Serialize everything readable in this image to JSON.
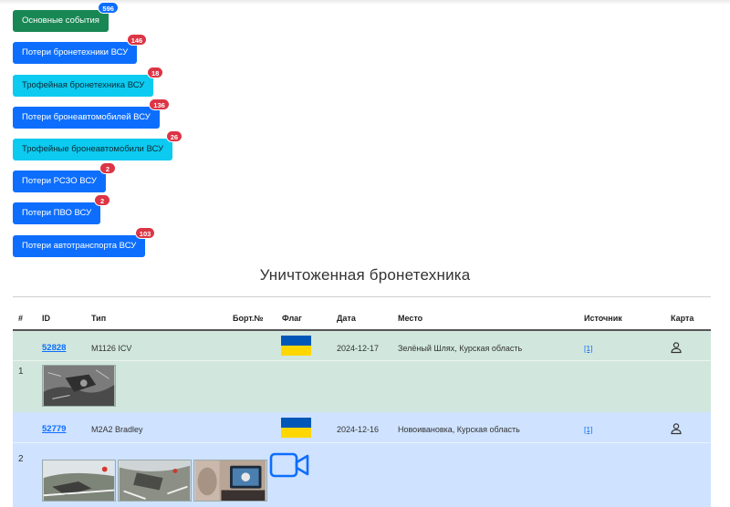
{
  "buttons": [
    {
      "label": "Основные события",
      "count": "596",
      "style": "green",
      "badge": "blue"
    },
    {
      "label": "Потери бронетехники ВСУ",
      "count": "146",
      "style": "blue",
      "badge": "red"
    },
    {
      "label": "Трофейная бронетехника ВСУ",
      "count": "18",
      "style": "cyan",
      "badge": "red"
    },
    {
      "label": "Потери бронеавтомобилей ВСУ",
      "count": "136",
      "style": "blue",
      "badge": "red"
    },
    {
      "label": "Трофейные бронеавтомобили ВСУ",
      "count": "26",
      "style": "cyan",
      "badge": "red"
    },
    {
      "label": "Потери РСЗО ВСУ",
      "count": "2",
      "style": "blue",
      "badge": "red"
    },
    {
      "label": "Потери ПВО ВСУ",
      "count": "2",
      "style": "blue",
      "badge": "red"
    },
    {
      "label": "Потери автотранспорта ВСУ",
      "count": "103",
      "style": "blue",
      "badge": "red"
    }
  ],
  "section": {
    "title": "Уничтоженная бронетехника"
  },
  "table": {
    "headers": {
      "num": "#",
      "id": "ID",
      "type": "Тип",
      "board": "Борт.№",
      "flag": "Флаг",
      "date": "Дата",
      "place": "Место",
      "source": "Источник",
      "map": "Карта"
    },
    "rows": [
      {
        "num": "1",
        "id": "52828",
        "type": "M1126 ICV",
        "board": "",
        "flag": "ukraine",
        "date": "2024-12-17",
        "place": "Зелёный Шлях, Курская область",
        "source": "[1]",
        "map_icon": "person-pin-icon",
        "row_color": "#d1e7dd",
        "photos": 1,
        "video": false
      },
      {
        "num": "2",
        "id": "52779",
        "type": "M2A2 Bradley",
        "board": "",
        "flag": "ukraine",
        "date": "2024-12-16",
        "place": "Новоивановка, Курская область",
        "source": "[1]",
        "map_icon": "person-pin-icon",
        "row_color": "#cfe2ff",
        "photos": 3,
        "video": true
      }
    ]
  },
  "colors": {
    "green": "#198754",
    "blue": "#0d6efd",
    "cyan": "#0dcaf0",
    "badge_red": "#dc3545",
    "flag_blue": "#0057b7",
    "flag_yellow": "#ffd700"
  }
}
